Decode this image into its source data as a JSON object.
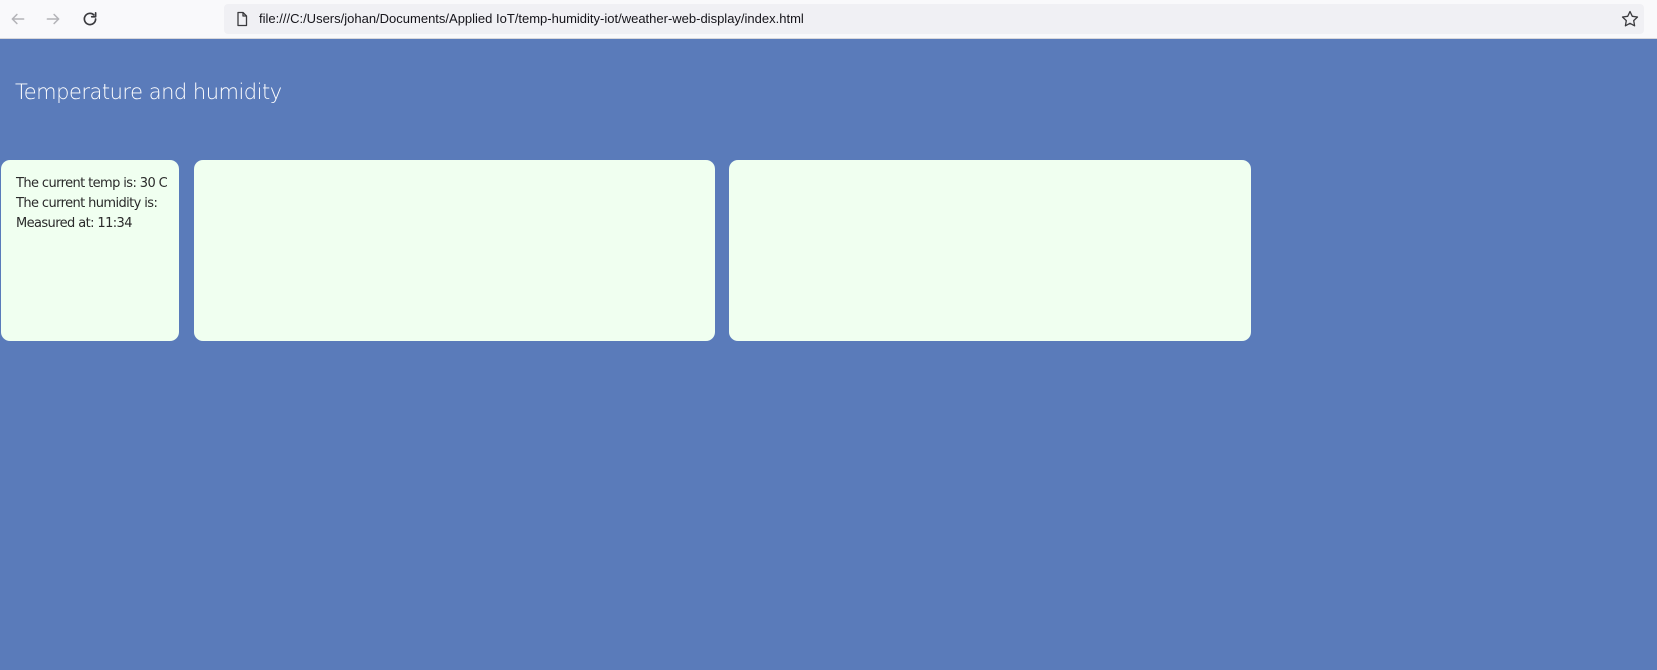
{
  "browser": {
    "url": "file:///C:/Users/johan/Documents/Applied IoT/temp-humidity-iot/weather-web-display/index.html"
  },
  "page": {
    "title": "Temperature and humidity",
    "readings": {
      "temp": "The current temp is: 30 C",
      "humidity": "The current humidity is:",
      "measured": "Measured at: 11:34"
    }
  },
  "colors": {
    "background": "#5a7bba",
    "card": "#f0fff0",
    "title_text": "#ffffff"
  }
}
